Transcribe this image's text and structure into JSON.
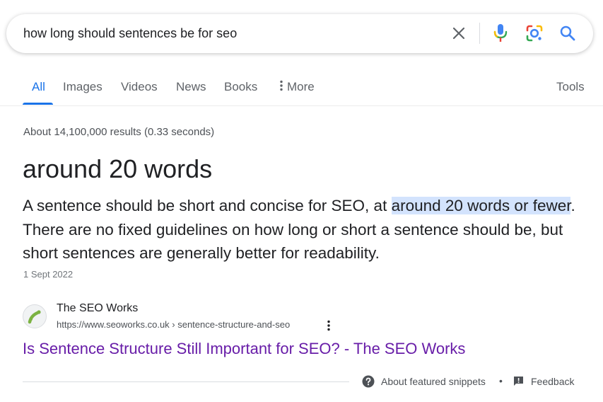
{
  "search": {
    "query": "how long should sentences be for seo"
  },
  "icons": {
    "clear": "close-icon",
    "voice": "microphone-icon",
    "lens": "google-lens-icon",
    "search": "magnifier-icon",
    "more": "vertical-dots-icon",
    "help": "question-circle-icon",
    "feedback": "feedback-icon"
  },
  "tabs": [
    {
      "label": "All",
      "active": true
    },
    {
      "label": "Images"
    },
    {
      "label": "Videos"
    },
    {
      "label": "News"
    },
    {
      "label": "Books"
    },
    {
      "label": "More"
    }
  ],
  "tools_label": "Tools",
  "result_stats": "About 14,100,000 results (0.33 seconds)",
  "featured_snippet": {
    "answer": "around 20 words",
    "text_before": "A sentence should be short and concise for SEO, at ",
    "text_highlight": "around 20 words or fewer",
    "text_after": ". There are no fixed guidelines on how long or short a sentence should be, but short sentences are generally better for readability.",
    "date": "1 Sept 2022"
  },
  "source": {
    "site_name": "The SEO Works",
    "url": "https://www.seoworks.co.uk › sentence-structure-and-seo",
    "title": "Is Sentence Structure Still Important for SEO? - The SEO Works"
  },
  "footer": {
    "about_label": "About featured snippets",
    "separator": "•",
    "feedback_label": "Feedback"
  },
  "colors": {
    "accent": "#1a73e8",
    "visited_link": "#681da8",
    "highlight": "#d3e3fd"
  }
}
